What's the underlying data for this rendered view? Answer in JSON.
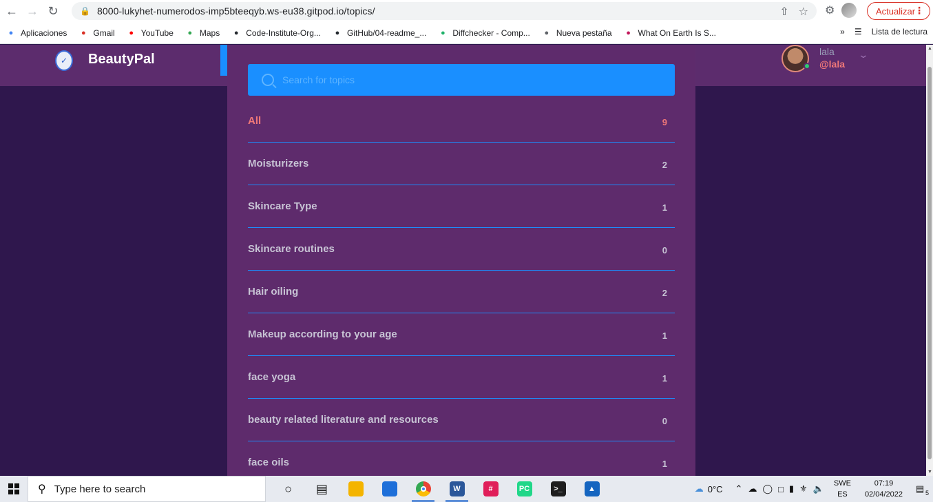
{
  "browser": {
    "url": "8000-lukyhet-numerodos-imp5bteeqyb.ws-eu38.gitpod.io/topics/",
    "update_label": "Actualizar",
    "bookmarks": [
      {
        "label": "Aplicaciones",
        "icon": "apps-grid-icon",
        "color": "#4285f4"
      },
      {
        "label": "Gmail",
        "icon": "gmail-icon",
        "color": "#d93025"
      },
      {
        "label": "YouTube",
        "icon": "youtube-icon",
        "color": "#ff0000"
      },
      {
        "label": "Maps",
        "icon": "maps-pin-icon",
        "color": "#34a853"
      },
      {
        "label": "Code-Institute-Org...",
        "icon": "github-icon",
        "color": "#24292e"
      },
      {
        "label": "GitHub/04-readme_...",
        "icon": "github-icon",
        "color": "#24292e"
      },
      {
        "label": "Diffchecker - Comp...",
        "icon": "diffchecker-icon",
        "color": "#20b26b"
      },
      {
        "label": "Nueva pestaña",
        "icon": "globe-icon",
        "color": "#5f6368"
      },
      {
        "label": "What On Earth Is S...",
        "icon": "h-icon",
        "color": "#c2185b"
      }
    ],
    "reading_list_label": "Lista de lectura"
  },
  "site": {
    "brand": "BeautyPal",
    "user_name": "lala",
    "user_handle": "@lala",
    "accent_color": "#1a8fff",
    "active_color": "#f07878"
  },
  "search": {
    "placeholder": "Search for topics"
  },
  "topics": [
    {
      "name": "All",
      "count": "9",
      "active": true
    },
    {
      "name": "Moisturizers",
      "count": "2",
      "active": false
    },
    {
      "name": "Skincare Type",
      "count": "1",
      "active": false
    },
    {
      "name": "Skincare routines",
      "count": "0",
      "active": false
    },
    {
      "name": "Hair oiling",
      "count": "2",
      "active": false
    },
    {
      "name": "Makeup according to your age",
      "count": "1",
      "active": false
    },
    {
      "name": "face yoga",
      "count": "1",
      "active": false
    },
    {
      "name": "beauty related literature and resources",
      "count": "0",
      "active": false
    },
    {
      "name": "face oils",
      "count": "1",
      "active": false
    }
  ],
  "taskbar": {
    "search_text": "Type here to search",
    "weather": "0°C",
    "lang_top": "SWE",
    "lang_bottom": "ES",
    "time": "07:19",
    "date": "02/04/2022",
    "notif_count": "5",
    "apps": [
      {
        "name": "cortana-icon",
        "color": "#111111",
        "glyph": "○",
        "active": false
      },
      {
        "name": "task-view-icon",
        "color": "#111111",
        "glyph": "▤",
        "active": false
      },
      {
        "name": "file-explorer-icon",
        "color": "#f4b400",
        "glyph": "",
        "active": false
      },
      {
        "name": "store-icon",
        "color": "#1e6fd9",
        "glyph": "",
        "active": false
      },
      {
        "name": "chrome-icon",
        "color": "#34a853",
        "glyph": "",
        "active": true
      },
      {
        "name": "word-icon",
        "color": "#2b579a",
        "glyph": "W",
        "active": true
      },
      {
        "name": "slack-icon",
        "color": "#e01e5a",
        "glyph": "#",
        "active": false
      },
      {
        "name": "pycharm-icon",
        "color": "#21d789",
        "glyph": "PC",
        "active": false
      },
      {
        "name": "terminal-icon",
        "color": "#1e1e1e",
        "glyph": ">_",
        "active": false
      },
      {
        "name": "photos-icon",
        "color": "#1565c0",
        "glyph": "▲",
        "active": false
      }
    ]
  }
}
